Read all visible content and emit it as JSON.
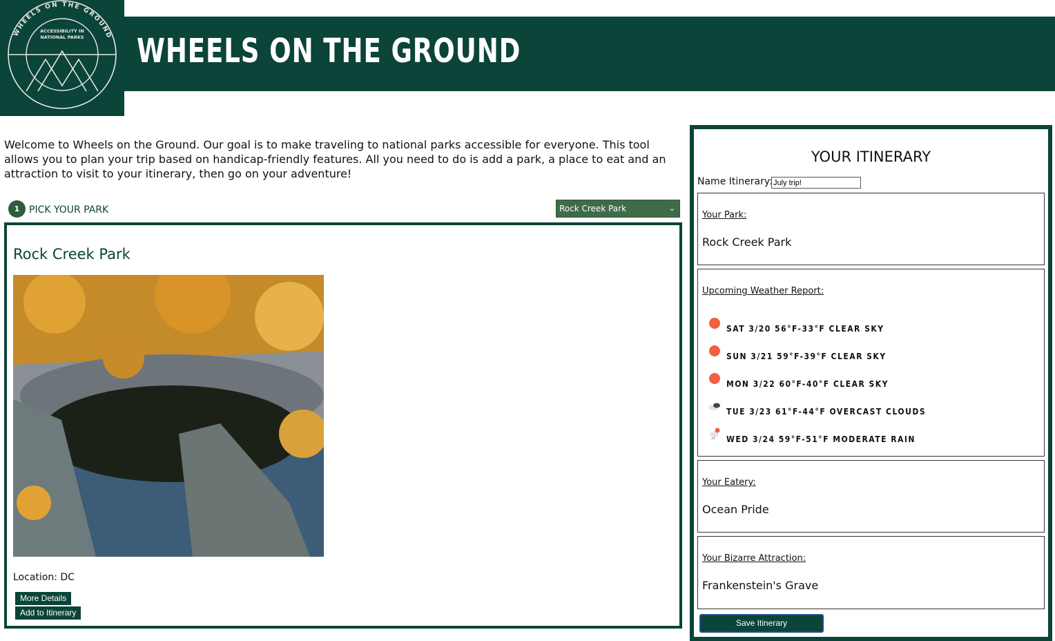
{
  "header": {
    "title": "WHEELS ON THE GROUND",
    "logo": {
      "ring_text": "WHEELS ON THE GROUND",
      "center_text_1": "ACCESSIBILITY IN",
      "center_text_2": "NATIONAL PARKS"
    }
  },
  "intro": "Welcome to Wheels on the Ground. Our goal is to make traveling to national parks accessible for everyone. This tool allows you to plan your trip based on handicap-friendly features. All you need to do is add a park, a place to eat and an attraction to visit to your itinerary, then go on your adventure!",
  "step": {
    "number": "1",
    "label": "PICK YOUR PARK"
  },
  "park_select": {
    "selected": "Rock Creek Park"
  },
  "park_card": {
    "name": "Rock Creek Park",
    "location": "Location: DC",
    "more_details": "More Details",
    "add_to_itinerary": "Add to Itinerary"
  },
  "itinerary": {
    "title": "YOUR ITINERARY",
    "name_label": "Name Itinerary:",
    "name_value": "July trip!",
    "park_label": "Your Park:",
    "park_value": "Rock Creek Park",
    "weather_label": "Upcoming Weather Report:",
    "weather": [
      {
        "text": "SAT 3/20 56°F-33°F CLEAR SKY",
        "icon": "sun-icon"
      },
      {
        "text": "SUN 3/21 59°F-39°F CLEAR SKY",
        "icon": "sun-icon"
      },
      {
        "text": "MON 3/22 60°F-40°F CLEAR SKY",
        "icon": "sun-icon"
      },
      {
        "text": "TUE 3/23 61°F-44°F OVERCAST CLOUDS",
        "icon": "clouds-icon"
      },
      {
        "text": "WED 3/24 59°F-51°F MODERATE RAIN",
        "icon": "rain-icon"
      }
    ],
    "eatery_label": "Your Eatery:",
    "eatery_value": "Ocean Pride",
    "attraction_label": "Your Bizarre Attraction:",
    "attraction_value": "Frankenstein's Grave",
    "save_label": "Save Itinerary"
  },
  "colors": {
    "brand": "#0b4438",
    "accent": "#3f6b48",
    "sun": "#f2603f"
  }
}
